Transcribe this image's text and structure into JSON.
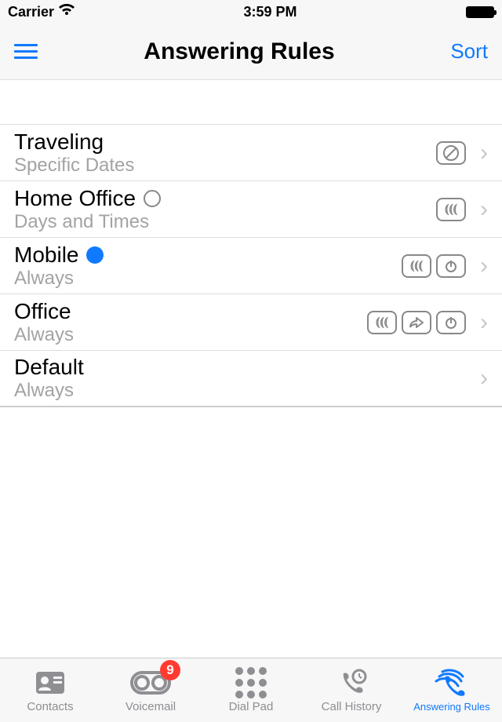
{
  "status": {
    "carrier": "Carrier",
    "time": "3:59 PM"
  },
  "nav": {
    "title": "Answering Rules",
    "sort_label": "Sort"
  },
  "rules": [
    {
      "title": "Traveling",
      "sub": "Specific Dates",
      "indicator": null,
      "icons": [
        "block"
      ]
    },
    {
      "title": "Home Office",
      "sub": "Days and Times",
      "indicator": "empty",
      "icons": [
        "ccc"
      ]
    },
    {
      "title": "Mobile",
      "sub": "Always",
      "indicator": "filled",
      "icons": [
        "ccc",
        "power"
      ]
    },
    {
      "title": "Office",
      "sub": "Always",
      "indicator": null,
      "icons": [
        "ccc",
        "forward",
        "power"
      ]
    },
    {
      "title": "Default",
      "sub": "Always",
      "indicator": null,
      "icons": []
    }
  ],
  "tabs": {
    "contacts": "Contacts",
    "voicemail": "Voicemail",
    "voicemail_badge": "9",
    "dialpad": "Dial Pad",
    "callhistory": "Call History",
    "answeringrules": "Answering Rules"
  }
}
